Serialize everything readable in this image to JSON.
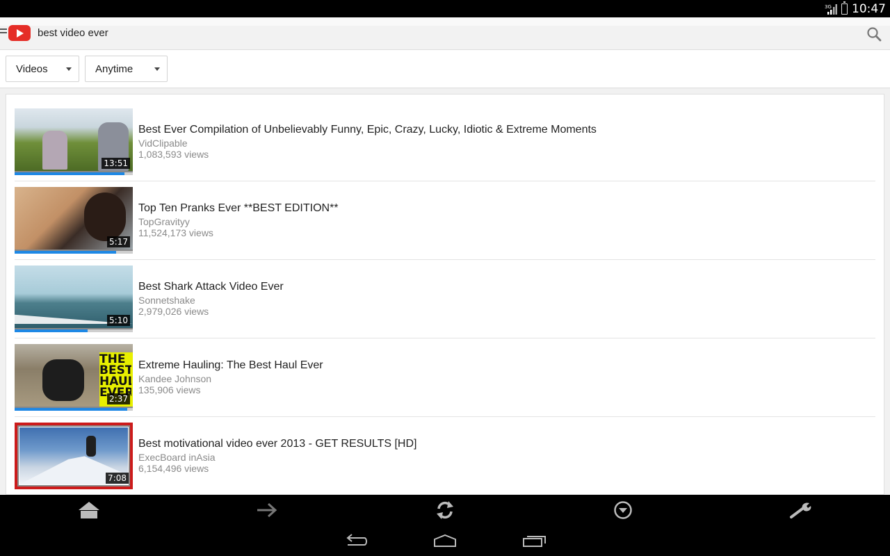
{
  "status_bar": {
    "network": "3G",
    "time": "10:47"
  },
  "header": {
    "search_query": "best video ever"
  },
  "filters": {
    "type_label": "Videos",
    "time_label": "Anytime"
  },
  "videos": [
    {
      "title": "Best Ever Compilation of Unbelievably Funny, Epic, Crazy, Lucky, Idiotic & Extreme Moments",
      "channel": "VidClipable",
      "views": "1,083,593 views",
      "duration": "13:51",
      "progress": 0.93
    },
    {
      "title": "Top Ten Pranks Ever **BEST EDITION**",
      "channel": "TopGravityy",
      "views": "11,524,173 views",
      "duration": "5:17",
      "progress": 0.86
    },
    {
      "title": "Best Shark Attack Video Ever",
      "channel": "Sonnetshake",
      "views": "2,979,026 views",
      "duration": "5:10",
      "progress": 0.62
    },
    {
      "title": "Extreme Hauling: The Best Haul Ever",
      "channel": "Kandee Johnson",
      "views": "135,906 views",
      "duration": "2:37",
      "progress": 0.95,
      "thumb_text": "THE BEST HAUL EVER"
    },
    {
      "title": "Best motivational video ever 2013 - GET RESULTS [HD]",
      "channel": "ExecBoard inAsia",
      "views": "6,154,496 views",
      "duration": "7:08",
      "progress": 0,
      "selected": true
    }
  ],
  "colors": {
    "accent": "#1e88e5",
    "selection": "#cc1b1b",
    "brand": "#e52d27"
  },
  "icons": {
    "toolbar": [
      "home-icon",
      "forward-arrow-icon",
      "refresh-icon",
      "dropdown-circle-icon",
      "wrench-icon"
    ],
    "navbar": [
      "back-icon",
      "home-outline-icon",
      "recents-icon"
    ]
  }
}
